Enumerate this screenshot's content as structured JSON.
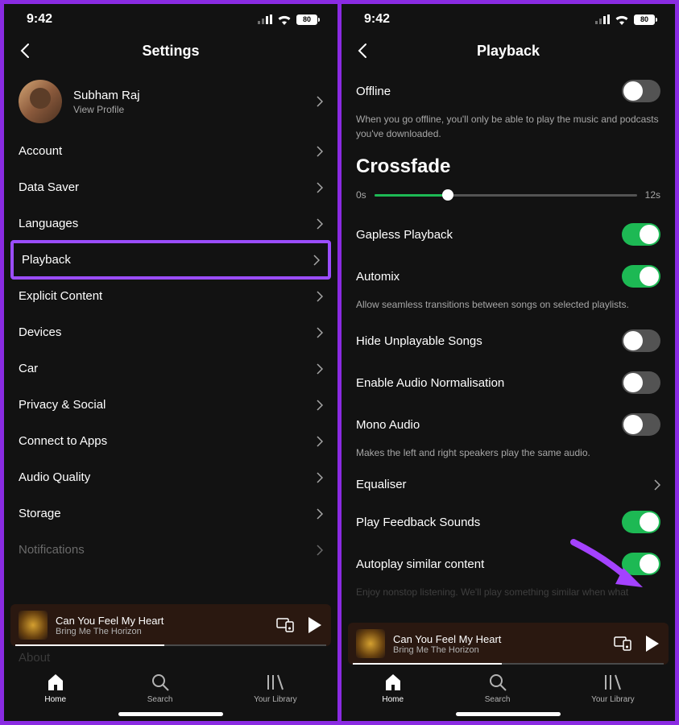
{
  "status": {
    "time": "9:42",
    "battery": "80"
  },
  "left": {
    "title": "Settings",
    "profile": {
      "name": "Subham Raj",
      "sub": "View Profile"
    },
    "items": [
      "Account",
      "Data Saver",
      "Languages",
      "Playback",
      "Explicit Content",
      "Devices",
      "Car",
      "Privacy & Social",
      "Connect to Apps",
      "Audio Quality",
      "Storage",
      "Notifications"
    ],
    "cut_off": "About"
  },
  "right": {
    "title": "Playback",
    "offline": {
      "label": "Offline",
      "desc": "When you go offline, you'll only be able to play the music and podcasts you've downloaded."
    },
    "crossfade": {
      "title": "Crossfade",
      "min": "0s",
      "max": "12s"
    },
    "gapless": "Gapless Playback",
    "automix": {
      "label": "Automix",
      "desc": "Allow seamless transitions between songs on selected playlists."
    },
    "hide": "Hide Unplayable Songs",
    "norm": "Enable Audio Normalisation",
    "mono": {
      "label": "Mono Audio",
      "desc": "Makes the left and right speakers play the same audio."
    },
    "eq": "Equaliser",
    "feedback": "Play Feedback Sounds",
    "autoplay": {
      "label": "Autoplay similar content",
      "desc": "Enjoy nonstop listening. We'll play something similar when what"
    }
  },
  "player": {
    "title": "Can You Feel My Heart",
    "artist": "Bring Me The Horizon"
  },
  "nav": {
    "home": "Home",
    "search": "Search",
    "library": "Your Library"
  }
}
